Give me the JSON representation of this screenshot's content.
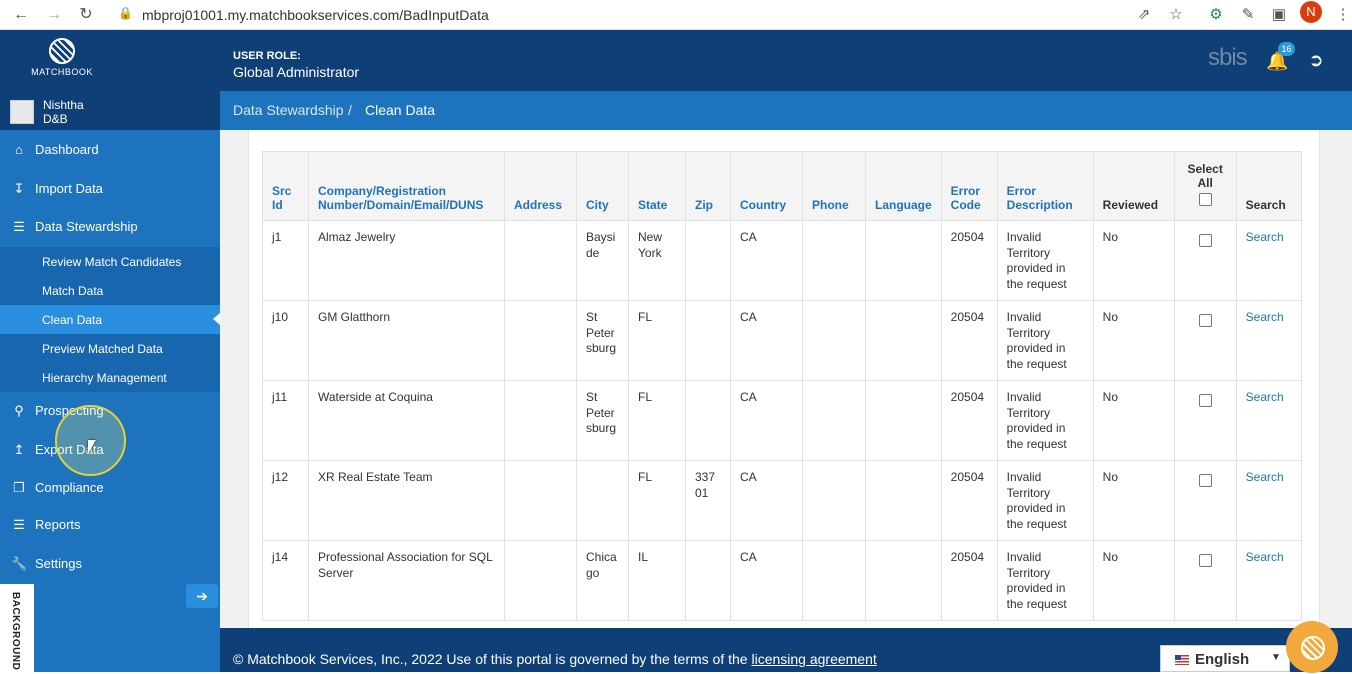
{
  "browser": {
    "url": "mbproj01001.my.matchbookservices.com/BadInputData",
    "avatar_letter": "N"
  },
  "header": {
    "logo_text": "MATCHBOOK",
    "role_label": "USER ROLE:",
    "role_value": "Global Administrator",
    "brand_right": "sbis",
    "notification_count": "16"
  },
  "sidebar": {
    "user_name_line1": "Nishtha",
    "user_name_line2": "D&B",
    "items": [
      {
        "label": "Dashboard",
        "icon": "home-icon"
      },
      {
        "label": "Import Data",
        "icon": "import-icon"
      },
      {
        "label": "Data Stewardship",
        "icon": "list-icon"
      },
      {
        "label": "Prospecting",
        "icon": "search-icon"
      },
      {
        "label": "Export Data",
        "icon": "export-icon"
      },
      {
        "label": "Compliance",
        "icon": "copy-icon"
      },
      {
        "label": "Reports",
        "icon": "list-icon"
      },
      {
        "label": "Settings",
        "icon": "wrench-icon"
      }
    ],
    "subitems": [
      {
        "label": "Review Match Candidates"
      },
      {
        "label": "Match Data"
      },
      {
        "label": "Clean Data"
      },
      {
        "label": "Preview Matched Data"
      },
      {
        "label": "Hierarchy Management"
      }
    ],
    "background_tab": "BACKGROUND"
  },
  "breadcrumb": {
    "parent": "Data Stewardship",
    "separator": "/",
    "current": "Clean Data"
  },
  "table": {
    "headers": {
      "src_id": "Src Id",
      "company": "Company/Registration Number/Domain/Email/DUNS",
      "address": "Address",
      "city": "City",
      "state": "State",
      "zip": "Zip",
      "country": "Country",
      "phone": "Phone",
      "language": "Language",
      "error_code": "Error Code",
      "error_description": "Error Description",
      "reviewed": "Reviewed",
      "select_all": "Select All",
      "search": "Search"
    },
    "rows": [
      {
        "src_id": "j1",
        "company": "Almaz Jewelry",
        "address": "",
        "city": "Baysi de",
        "state": "New York",
        "zip": "",
        "country": "CA",
        "phone": "",
        "language": "",
        "error_code": "20504",
        "error_description": "Invalid Territory provided in the request",
        "reviewed": "No",
        "search": "Search"
      },
      {
        "src_id": "j10",
        "company": "GM Glatthorn",
        "address": "",
        "city": "St Peter sburg",
        "state": "FL",
        "zip": "",
        "country": "CA",
        "phone": "",
        "language": "",
        "error_code": "20504",
        "error_description": "Invalid Territory provided in the request",
        "reviewed": "No",
        "search": "Search"
      },
      {
        "src_id": "j11",
        "company": "Waterside at Coquina",
        "address": "",
        "city": "St Peter sburg",
        "state": "FL",
        "zip": "",
        "country": "CA",
        "phone": "",
        "language": "",
        "error_code": "20504",
        "error_description": "Invalid Territory provided in the request",
        "reviewed": "No",
        "search": "Search"
      },
      {
        "src_id": "j12",
        "company": "XR Real Estate Team",
        "address": "",
        "city": "",
        "state": "FL",
        "zip": "337 01",
        "country": "CA",
        "phone": "",
        "language": "",
        "error_code": "20504",
        "error_description": "Invalid Territory provided in the request",
        "reviewed": "No",
        "search": "Search"
      },
      {
        "src_id": "j14",
        "company": "Professional Association for SQL Server",
        "address": "",
        "city": "Chica go",
        "state": "IL",
        "zip": "",
        "country": "CA",
        "phone": "",
        "language": "",
        "error_code": "20504",
        "error_description": "Invalid Territory provided in the request",
        "reviewed": "No",
        "search": "Search"
      }
    ]
  },
  "footer": {
    "text": "© Matchbook Services, Inc., 2022 Use of this portal is governed by the terms of the",
    "link": "licensing agreement"
  },
  "language": {
    "selected": "English"
  },
  "colors": {
    "header_navy": "#0f3f77",
    "sidebar_blue": "#1e73be",
    "active_blue": "#2b8fe0",
    "link_blue": "#1e73be",
    "accent_orange": "#f3a83b"
  }
}
